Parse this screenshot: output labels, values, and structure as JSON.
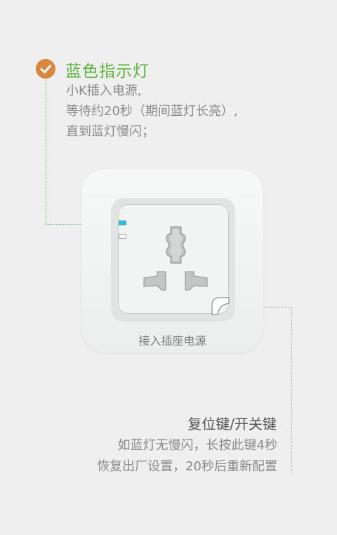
{
  "blue_indicator": {
    "title": "蓝色指示灯",
    "icon": "check-circle-icon",
    "steps": [
      "小K插入电源,",
      "等待约20秒（期间蓝灯长亮）,",
      "直到蓝灯慢闪；"
    ]
  },
  "socket": {
    "caption": "接入插座电源",
    "led_color": "#20c3e1"
  },
  "reset": {
    "title": "复位键/开关键",
    "desc": [
      "如蓝灯无慢闪，长按此键4秒",
      "恢复出厂设置，20秒后重新配置"
    ]
  },
  "colors": {
    "title_green": "#5cb33c",
    "badge_orange": "#d9873e",
    "background": "#efefef"
  }
}
